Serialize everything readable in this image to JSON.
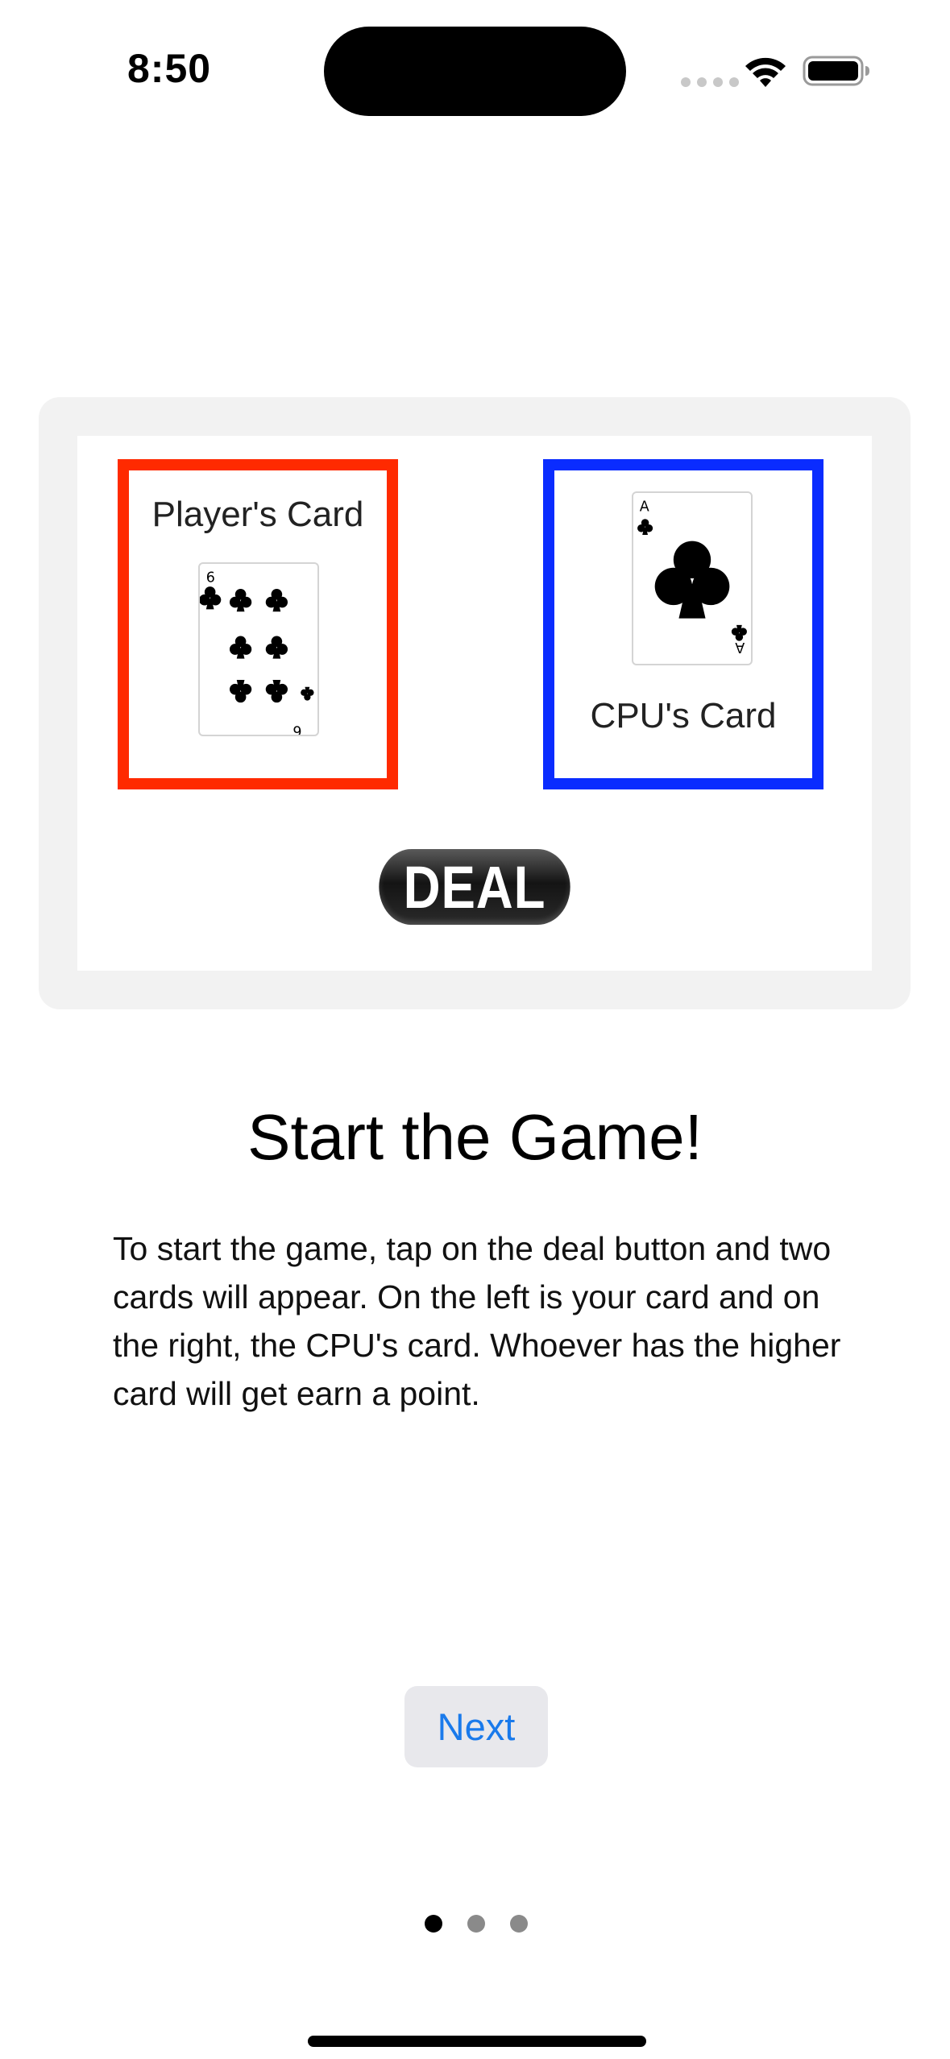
{
  "status_bar": {
    "time": "8:50",
    "icons": [
      "cellular-signal-icon",
      "wifi-icon",
      "battery-icon"
    ]
  },
  "preview": {
    "player_label": "Player's Card",
    "cpu_label": "CPU's Card",
    "player_card": {
      "rank": "6",
      "suit": "clubs"
    },
    "cpu_card": {
      "rank": "A",
      "suit": "clubs"
    },
    "deal_label": "DEAL",
    "colors": {
      "player_border": "#ff2a00",
      "cpu_border": "#0a2cff"
    }
  },
  "content": {
    "title": "Start the Game!",
    "body": "To start the game, tap on the deal button and two cards will appear. On the left is your card and on the right, the CPU's card. Whoever has the higher card will get earn a point."
  },
  "next_button": {
    "label": "Next",
    "color": "#1a7aeb"
  },
  "pagination": {
    "current_page": 1,
    "total_pages": 3
  }
}
